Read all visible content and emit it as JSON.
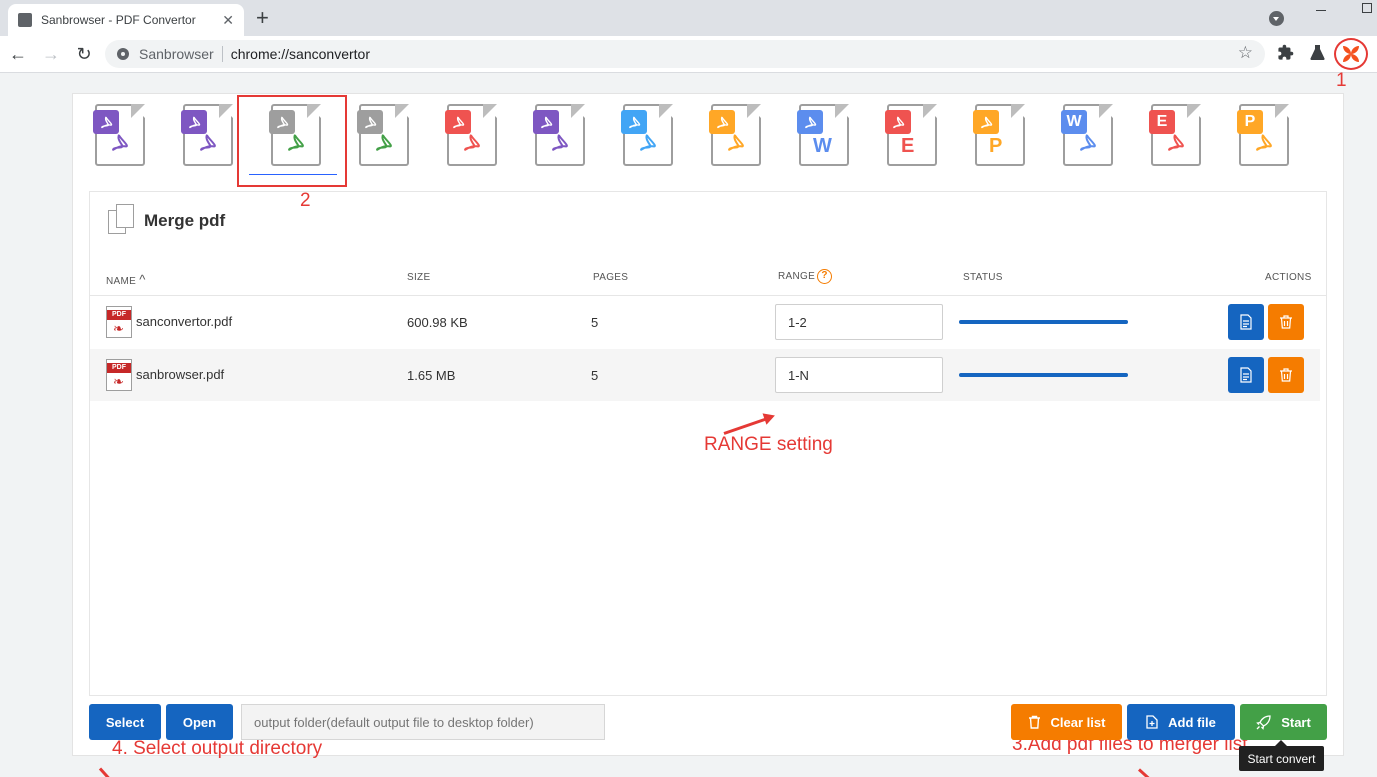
{
  "browser": {
    "tab_title": "Sanbrowser - PDF Convertor",
    "tab_close": "✕",
    "new_tab": "+",
    "site_name": "Sanbrowser",
    "url": "chrome://sanconvertor",
    "back": "←",
    "forward": "→",
    "reload": "↻",
    "star": "☆",
    "extensions_icon": "puzzle-icon",
    "labs_icon": "flask-icon",
    "extension_icon": "sanconvertor-pinwheel-icon"
  },
  "annotations": {
    "a1": "1",
    "a2": "2",
    "range": "RANGE setting",
    "select_dir": "4. Select output directory",
    "add_files": "3.Add pdf files to merger list"
  },
  "tools": [
    {
      "name": "pdf-to-image",
      "badge_color": "#7e57c2",
      "glyph": ""
    },
    {
      "name": "image-to-pdf",
      "badge_color": "#7e57c2",
      "glyph": ""
    },
    {
      "name": "merge-pdf",
      "badge_color": "#9e9e9e",
      "glyph": "",
      "selected": true
    },
    {
      "name": "split-pdf",
      "badge_color": "#9e9e9e",
      "glyph": ""
    },
    {
      "name": "compress-pdf",
      "badge_color": "#ef5350",
      "glyph": ""
    },
    {
      "name": "pdf-to-text",
      "badge_color": "#7e57c2",
      "glyph": ""
    },
    {
      "name": "unlock-pdf",
      "badge_color": "#42a5f5",
      "glyph": ""
    },
    {
      "name": "protect-pdf",
      "badge_color": "#ffa726",
      "glyph": ""
    },
    {
      "name": "pdf-to-word",
      "badge_color": "#5c8dee",
      "glyph": "W"
    },
    {
      "name": "pdf-to-excel",
      "badge_color": "#ef5350",
      "glyph": "E"
    },
    {
      "name": "pdf-to-ppt",
      "badge_color": "#ffa726",
      "glyph": "P"
    },
    {
      "name": "word-to-pdf",
      "badge_color": "#5c8dee",
      "badge_text": "W"
    },
    {
      "name": "excel-to-pdf",
      "badge_color": "#ef5350",
      "badge_text": "E"
    },
    {
      "name": "ppt-to-pdf",
      "badge_color": "#ffa726",
      "badge_text": "P"
    }
  ],
  "panel": {
    "title": "Merge pdf",
    "columns": {
      "name": "NAME",
      "size": "SIZE",
      "pages": "PAGES",
      "range": "RANGE",
      "status": "STATUS",
      "actions": "ACTIONS"
    },
    "sort_indicator": "^",
    "range_help": "?",
    "files": [
      {
        "name": "sanconvertor.pdf",
        "size": "600.98 KB",
        "pages": "5",
        "range": "1-2",
        "progress": 1.0
      },
      {
        "name": "sanbrowser.pdf",
        "size": "1.65 MB",
        "pages": "5",
        "range": "1-N",
        "progress": 1.0
      }
    ],
    "file_tag": "PDF"
  },
  "footer": {
    "select_label": "Select",
    "open_label": "Open",
    "output_placeholder": "output folder(default output file to desktop folder)",
    "clear_label": "Clear list",
    "add_label": "Add file",
    "start_label": "Start",
    "tooltip": "Start convert"
  },
  "colors": {
    "primary": "#1565c0",
    "warning": "#f57c00",
    "success": "#43a047",
    "annotation": "#e53935"
  }
}
